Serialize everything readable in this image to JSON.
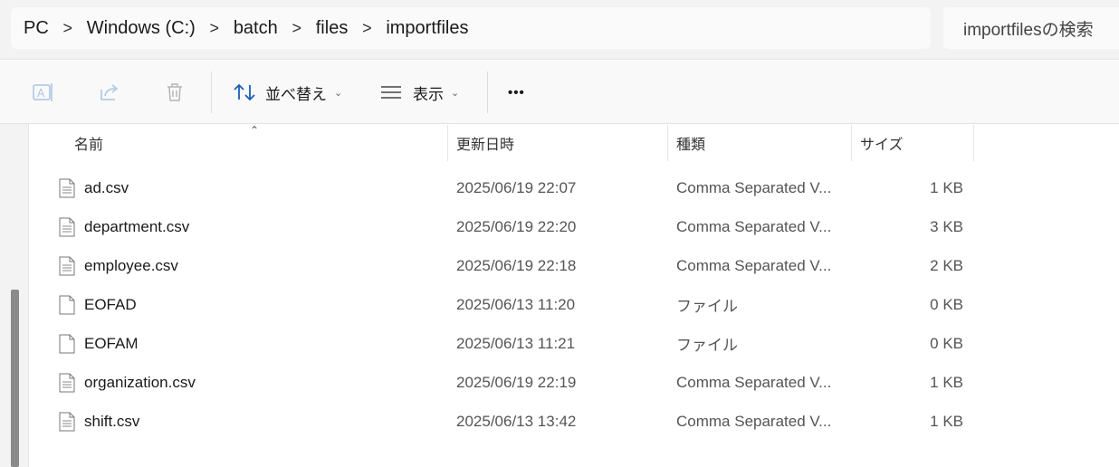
{
  "address_bar": {
    "crumbs": [
      "PC",
      "Windows (C:)",
      "batch",
      "files",
      "importfiles"
    ],
    "separator": ">"
  },
  "search": {
    "placeholder": "importfilesの検索"
  },
  "command_bar": {
    "rename_icon": "rename-icon",
    "share_icon": "share-icon",
    "delete_icon": "trash-icon",
    "sort_label": "並べ替え",
    "view_label": "表示",
    "more_label": "•••"
  },
  "columns": {
    "name": "名前",
    "modified": "更新日時",
    "type": "種類",
    "size": "サイズ"
  },
  "files": [
    {
      "name": "ad.csv",
      "modified": "2025/06/19 22:07",
      "type": "Comma Separated V...",
      "size": "1 KB",
      "icon": "text-file-icon"
    },
    {
      "name": "department.csv",
      "modified": "2025/06/19 22:20",
      "type": "Comma Separated V...",
      "size": "3 KB",
      "icon": "text-file-icon"
    },
    {
      "name": "employee.csv",
      "modified": "2025/06/19 22:18",
      "type": "Comma Separated V...",
      "size": "2 KB",
      "icon": "text-file-icon"
    },
    {
      "name": "EOFAD",
      "modified": "2025/06/13 11:20",
      "type": "ファイル",
      "size": "0 KB",
      "icon": "blank-file-icon"
    },
    {
      "name": "EOFAM",
      "modified": "2025/06/13 11:21",
      "type": "ファイル",
      "size": "0 KB",
      "icon": "blank-file-icon"
    },
    {
      "name": "organization.csv",
      "modified": "2025/06/19 22:19",
      "type": "Comma Separated V...",
      "size": "1 KB",
      "icon": "text-file-icon"
    },
    {
      "name": "shift.csv",
      "modified": "2025/06/13 13:42",
      "type": "Comma Separated V...",
      "size": "1 KB",
      "icon": "text-file-icon"
    }
  ]
}
